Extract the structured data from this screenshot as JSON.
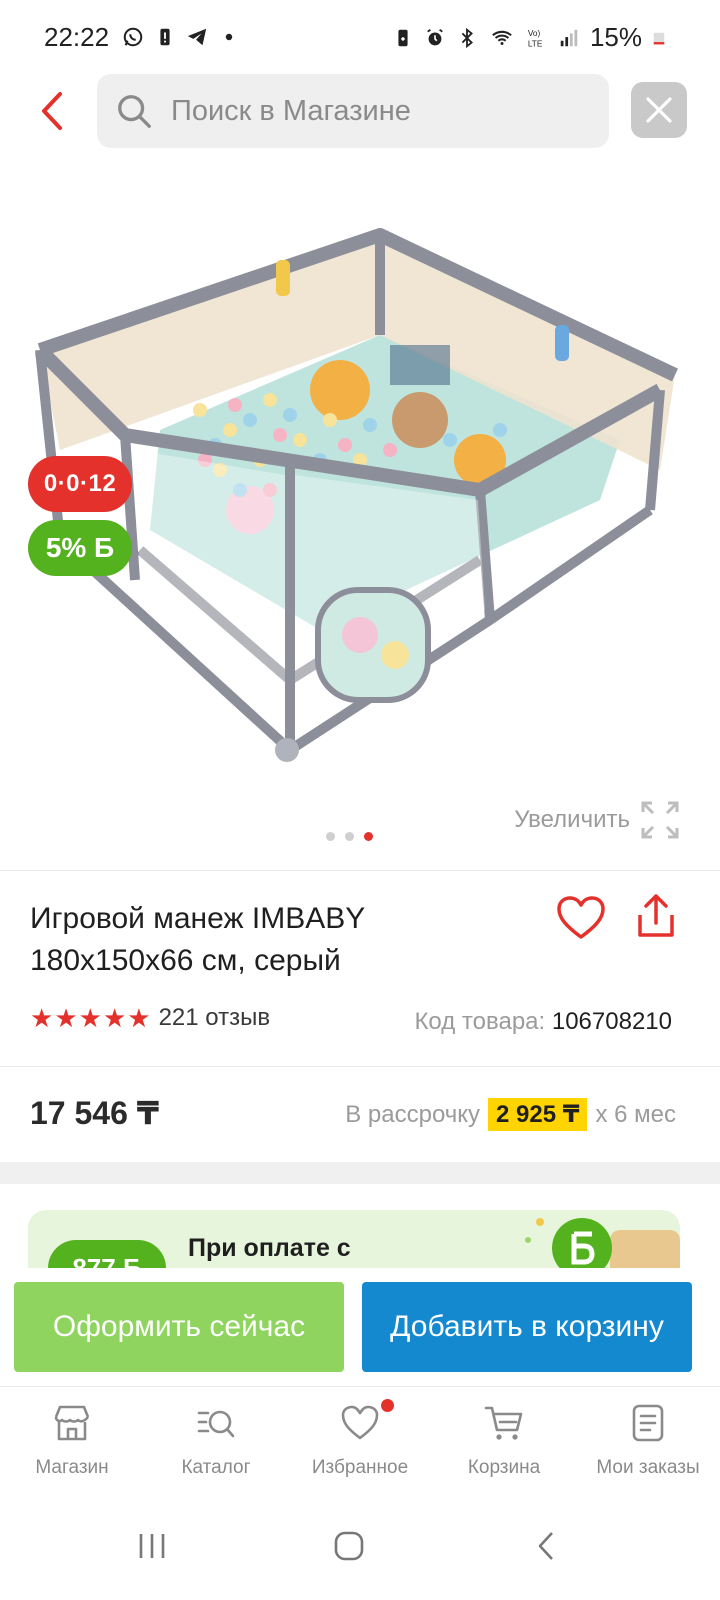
{
  "status_bar": {
    "time": "22:22",
    "battery_percent": "15%"
  },
  "search": {
    "placeholder": "Поиск в Магазине"
  },
  "product_image": {
    "badge_installment": "0·0·12",
    "badge_bonus": "5% Б",
    "zoom_label": "Увеличить",
    "slide_count": 3,
    "active_slide": 3
  },
  "product": {
    "title": "Игровой манеж IMBABY 180x150x66 см, серый",
    "rating_stars": 5,
    "reviews": "221 отзыв",
    "sku_label": "Код товара:",
    "sku_value": "106708210",
    "price": "17 546 ₸",
    "installment_prefix": "В рассрочку",
    "installment_amount": "2 925 ₸",
    "installment_suffix": "х 6 мес"
  },
  "promo": {
    "chip": "877 Б",
    "text": "При оплате с"
  },
  "actions": {
    "buy_now": "Оформить сейчас",
    "add_to_cart": "Добавить в корзину"
  },
  "bottom_nav": {
    "items": [
      {
        "label": "Магазин",
        "icon": "store-icon"
      },
      {
        "label": "Каталог",
        "icon": "catalog-search-icon"
      },
      {
        "label": "Избранное",
        "icon": "heart-icon"
      },
      {
        "label": "Корзина",
        "icon": "cart-icon"
      },
      {
        "label": "Мои заказы",
        "icon": "orders-icon"
      }
    ]
  },
  "colors": {
    "accent_red": "#e4312b",
    "buy_green": "#8fd45f",
    "cart_blue": "#1489d0",
    "bonus_green": "#55b21f",
    "installment_yellow": "#ffd400"
  }
}
